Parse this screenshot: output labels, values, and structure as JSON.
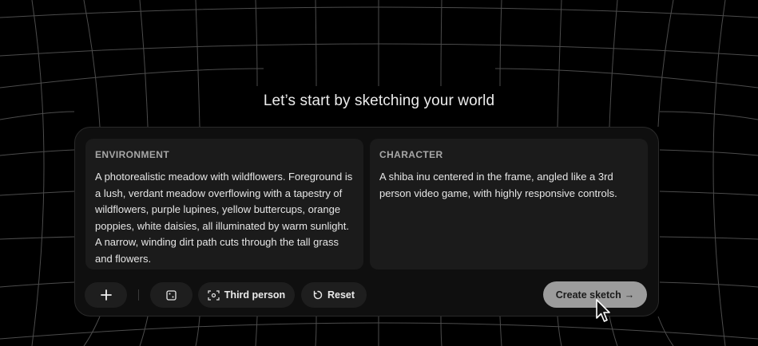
{
  "headline": "Let’s start by sketching your world",
  "environment": {
    "label": "ENVIRONMENT",
    "text": "A photorealistic meadow with wildflowers. Foreground is a lush, verdant meadow overflowing with a tapestry of wildflowers, purple lupines, yellow buttercups, orange poppies, white daisies, all illuminated by warm sunlight. A narrow, winding dirt path cuts through the tall grass and flowers."
  },
  "character": {
    "label": "CHARACTER",
    "text": "A shiba inu centered in the frame, angled like a 3rd person video game, with highly responsive controls."
  },
  "toolbar": {
    "add_icon": "plus-icon",
    "random_icon": "dice-icon",
    "perspective_icon": "camera-view-icon",
    "perspective_label": "Third person",
    "reset_icon": "reset-icon",
    "reset_label": "Reset",
    "create_label": "Create sketch",
    "create_arrow": "→"
  },
  "colors": {
    "background": "#000000",
    "panel": "#0f0f0f",
    "card": "#1b1b1b",
    "create_button": "#9c9c9c"
  }
}
